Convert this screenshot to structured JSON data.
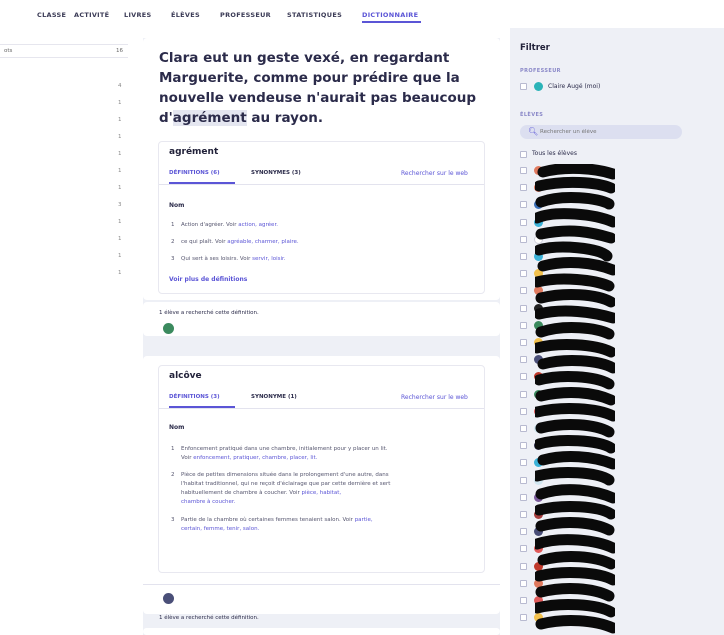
{
  "nav": {
    "tabs": [
      {
        "label": "CLASSE",
        "active": false
      },
      {
        "label": "ACTIVITÉ",
        "active": false
      },
      {
        "label": "LIVRES",
        "active": false
      },
      {
        "label": "ÉLÈVES",
        "active": false
      },
      {
        "label": "PROFESSEUR",
        "active": false
      },
      {
        "label": "STATISTIQUES",
        "active": false
      },
      {
        "label": "DICTIONNAIRE",
        "active": true
      }
    ]
  },
  "left": {
    "header_label": "ots",
    "header_count": "16",
    "counts": [
      "4",
      "1",
      "1",
      "1",
      "1",
      "1",
      "1",
      "3",
      "1",
      "1",
      "1",
      "1"
    ]
  },
  "sentence": {
    "before": "Clara eut un geste vexé, en regardant Marguerite, comme pour prédire que la nouvelle vendeuse n'aurait pas beaucoup d'",
    "highlight": "agrément",
    "after": " au rayon."
  },
  "entries": [
    {
      "word": "agrément",
      "tab_definitions": "DÉFINITIONS (6)",
      "tab_synonyms": "SYNONYMES (3)",
      "web_link": "Rechercher sur le web",
      "pos": "Nom",
      "definitions": [
        {
          "n": "1",
          "text": "Action d'agréer. Voir ",
          "links": "action, agréer."
        },
        {
          "n": "2",
          "text": "ce qui plaît. Voir ",
          "links": "agréable, charmer, plaire."
        },
        {
          "n": "3",
          "text": "Qui sert à ses loisirs. Voir ",
          "links": "servir, loisir."
        }
      ],
      "more": "Voir plus de définitions",
      "students": "1 élève a recherché cette définition.",
      "avatar_color": "#3b8a5e"
    },
    {
      "word": "alcôve",
      "tab_definitions": "DÉFINITIONS (3)",
      "tab_synonyms": "SYNONYME (1)",
      "web_link": "Rechercher sur le web",
      "pos": "Nom",
      "definitions": [
        {
          "n": "1",
          "line1": "Enfoncement pratiqué dans une chambre, initialement pour y placer un lit.",
          "line2_text": "Voir ",
          "line2_links": "enfoncement, pratiquer, chambre, placer, lit."
        },
        {
          "n": "2",
          "line1": "Pièce de petites dimensions située dans le prolongement d'une autre, dans",
          "line2": "l'habitat traditionnel, qui ne reçoit d'éclairage que par cette dernière et sert",
          "line3_text": "habituellement de chambre à coucher. Voir ",
          "line3_links": "pièce, habitat,",
          "line4_links": "chambre à coucher."
        },
        {
          "n": "3",
          "line1_text": "Partie de la chambre où certaines femmes tenaient salon. Voir ",
          "line1_links": "partie,",
          "line2_links": "certain, femme, tenir, salon."
        }
      ],
      "students": "1 élève a recherché cette définition.",
      "avatar_color": "#4a4f78"
    }
  ],
  "filter": {
    "title": "Filtrer",
    "teacher_section": "PROFESSEUR",
    "teacher_name": "Claire Augé (moi)",
    "students_section": "ÉLÈVES",
    "search_placeholder": "Rechercher un élève",
    "all_students": "Tous les élèves",
    "student_colors": [
      "#e07a5f",
      "#e07a5f",
      "#3a6fb8",
      "#3bb2d8",
      "#ffffff",
      "#3bb2d8",
      "#f2c14e",
      "#e07a5f",
      "#222222",
      "#3b8a5e",
      "#f2c14e",
      "#4a4f78",
      "#c0392b",
      "#3b8a5e",
      "#e05a5a",
      "#d0e6f0",
      "#2d2d4a",
      "#3bb2d8",
      "#d0e6f0",
      "#7a5a9a",
      "#a63d3d",
      "#4a4f78",
      "#e05a5a",
      "#c0392b",
      "#e07a5f",
      "#e05a5a",
      "#f2c14e"
    ]
  }
}
